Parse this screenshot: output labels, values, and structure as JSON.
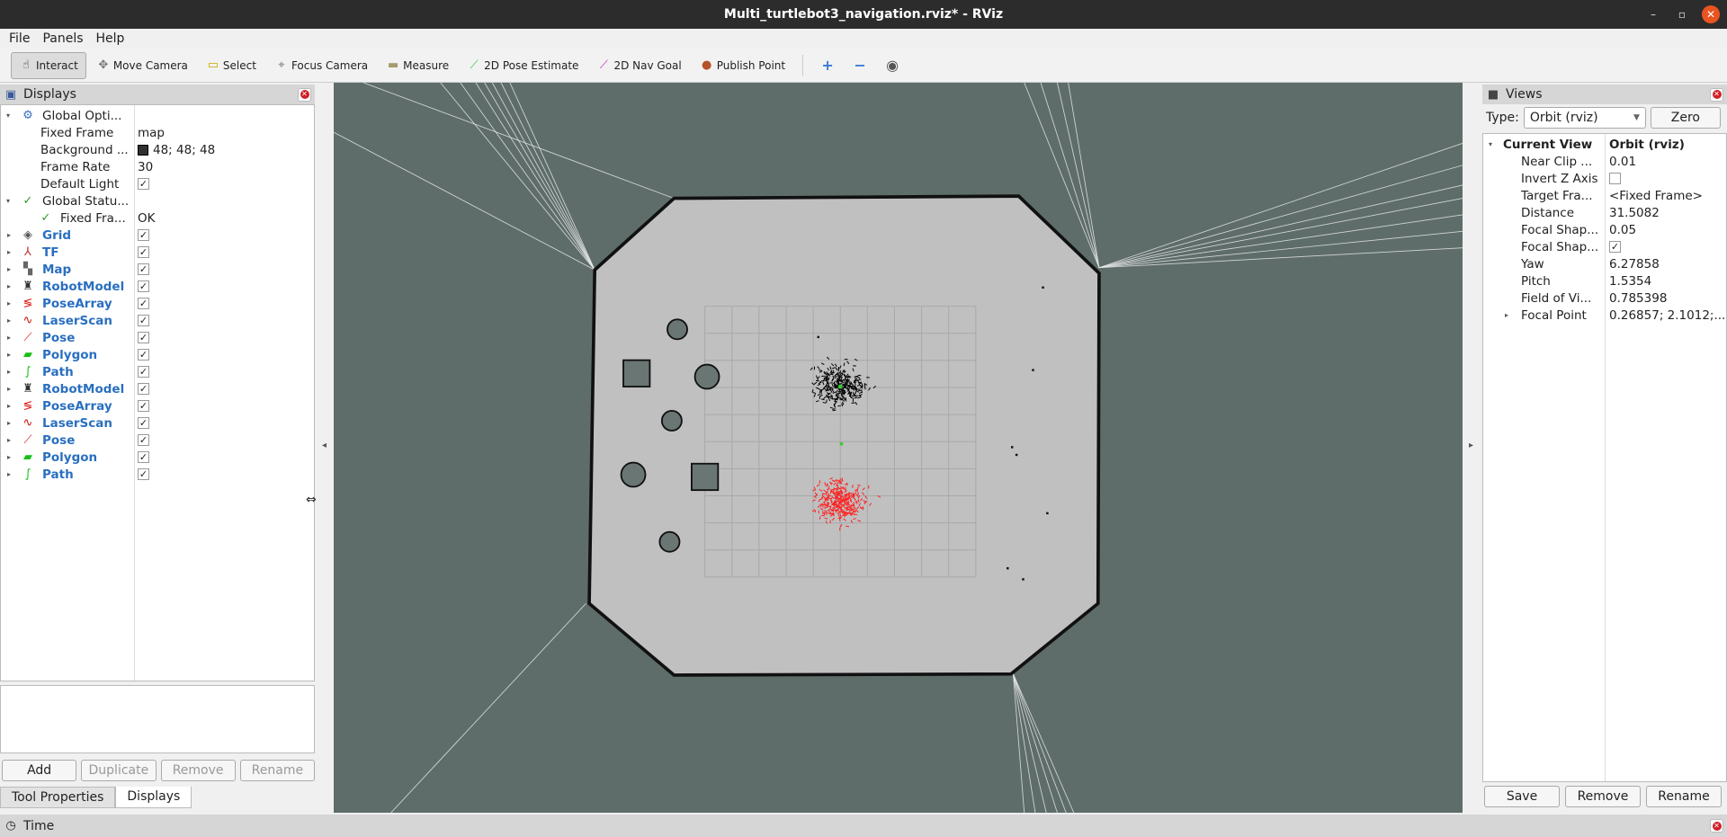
{
  "window": {
    "title": "Multi_turtlebot3_navigation.rviz* - RViz",
    "min": "–",
    "max": "▫",
    "close": "✕"
  },
  "menu": [
    "File",
    "Panels",
    "Help"
  ],
  "toolbar": [
    {
      "label": "Interact",
      "icon": "hand-pointer-icon",
      "glyph": "☝",
      "color": "#333",
      "active": true
    },
    {
      "label": "Move Camera",
      "icon": "move-camera-icon",
      "glyph": "✥",
      "color": "#777"
    },
    {
      "label": "Select",
      "icon": "select-box-icon",
      "glyph": "▭",
      "color": "#c9a500"
    },
    {
      "label": "Focus Camera",
      "icon": "focus-camera-icon",
      "glyph": "⌖",
      "color": "#777"
    },
    {
      "label": "Measure",
      "icon": "ruler-icon",
      "glyph": "▬",
      "color": "#a59a70"
    },
    {
      "label": "2D Pose Estimate",
      "icon": "green-arrow-icon",
      "glyph": "⟋",
      "color": "#2ecc40"
    },
    {
      "label": "2D Nav Goal",
      "icon": "magenta-arrow-icon",
      "glyph": "⟋",
      "color": "#d020c0"
    },
    {
      "label": "Publish Point",
      "icon": "map-pin-icon",
      "glyph": "●",
      "color": "#b5522a"
    }
  ],
  "toolbar_extra": {
    "add": "+",
    "remove": "−",
    "eye": "◉"
  },
  "displays": {
    "title": "Displays",
    "global_options": {
      "label": "Global Opti...",
      "props": [
        {
          "name": "Fixed Frame",
          "value": "map"
        },
        {
          "name": "Background ...",
          "value": "48; 48; 48",
          "swatch": "#303030"
        },
        {
          "name": "Frame Rate",
          "value": "30"
        },
        {
          "name": "Default Light",
          "checked": true
        }
      ]
    },
    "global_status": {
      "label": "Global Statu...",
      "child": {
        "name": "Fixed Fra...",
        "value": "OK"
      }
    },
    "items": [
      {
        "label": "Grid",
        "icon": "grid-icon",
        "glyph": "◈",
        "color": "#555",
        "checked": true
      },
      {
        "label": "TF",
        "icon": "tf-axes-icon",
        "glyph": "⅄",
        "color": "#c03030",
        "checked": true
      },
      {
        "label": "Map",
        "icon": "map-icon",
        "glyph": "▚",
        "color": "#666",
        "checked": true
      },
      {
        "label": "RobotModel",
        "icon": "robot-model-icon",
        "glyph": "♜",
        "color": "#333",
        "checked": true
      },
      {
        "label": "PoseArray",
        "icon": "pose-array-icon",
        "glyph": "≶",
        "color": "#e02020",
        "checked": true
      },
      {
        "label": "LaserScan",
        "icon": "laser-scan-icon",
        "glyph": "∿",
        "color": "#d01010",
        "checked": true
      },
      {
        "label": "Pose",
        "icon": "pose-arrow-icon",
        "glyph": "⟋",
        "color": "#e02020",
        "checked": true
      },
      {
        "label": "Polygon",
        "icon": "polygon-icon",
        "glyph": "▰",
        "color": "#18c018",
        "checked": true
      },
      {
        "label": "Path",
        "icon": "path-icon",
        "glyph": "∫",
        "color": "#18c018",
        "checked": true
      },
      {
        "label": "RobotModel",
        "icon": "robot-model-icon",
        "glyph": "♜",
        "color": "#333",
        "checked": true
      },
      {
        "label": "PoseArray",
        "icon": "pose-array-icon",
        "glyph": "≶",
        "color": "#e02020",
        "checked": true
      },
      {
        "label": "LaserScan",
        "icon": "laser-scan-icon",
        "glyph": "∿",
        "color": "#d01010",
        "checked": true
      },
      {
        "label": "Pose",
        "icon": "pose-arrow-icon",
        "glyph": "⟋",
        "color": "#e02020",
        "checked": true
      },
      {
        "label": "Polygon",
        "icon": "polygon-icon",
        "glyph": "▰",
        "color": "#18c018",
        "checked": true
      },
      {
        "label": "Path",
        "icon": "path-icon",
        "glyph": "∫",
        "color": "#18c018",
        "checked": true
      }
    ],
    "buttons": {
      "add": "Add",
      "duplicate": "Duplicate",
      "remove": "Remove",
      "rename": "Rename"
    },
    "tabs": [
      "Tool Properties",
      "Displays"
    ]
  },
  "views": {
    "title": "Views",
    "type_label": "Type:",
    "type_value": "Orbit (rviz)",
    "zero": "Zero",
    "current_view": {
      "label": "Current View",
      "value": "Orbit (rviz)"
    },
    "props": [
      {
        "name": "Near Clip ...",
        "value": "0.01"
      },
      {
        "name": "Invert Z Axis",
        "checked": false
      },
      {
        "name": "Target Fra...",
        "value": "<Fixed Frame>"
      },
      {
        "name": "Distance",
        "value": "31.5082"
      },
      {
        "name": "Focal Shap...",
        "value": "0.05"
      },
      {
        "name": "Focal Shap...",
        "checked": true
      },
      {
        "name": "Yaw",
        "value": "6.27858"
      },
      {
        "name": "Pitch",
        "value": "1.5354"
      },
      {
        "name": "Field of Vi...",
        "value": "0.785398"
      },
      {
        "name": "Focal Point",
        "value": "0.26857; 2.1012;...",
        "expandable": true
      }
    ],
    "buttons": {
      "save": "Save",
      "remove": "Remove",
      "rename": "Rename"
    }
  },
  "time": {
    "title": "Time"
  },
  "scene": {
    "background": "#5e6d6a",
    "floor": "#c0c0c0",
    "grid": "#a8a8a8",
    "cloud1": "#000000",
    "cloud2": "#ff2020"
  }
}
